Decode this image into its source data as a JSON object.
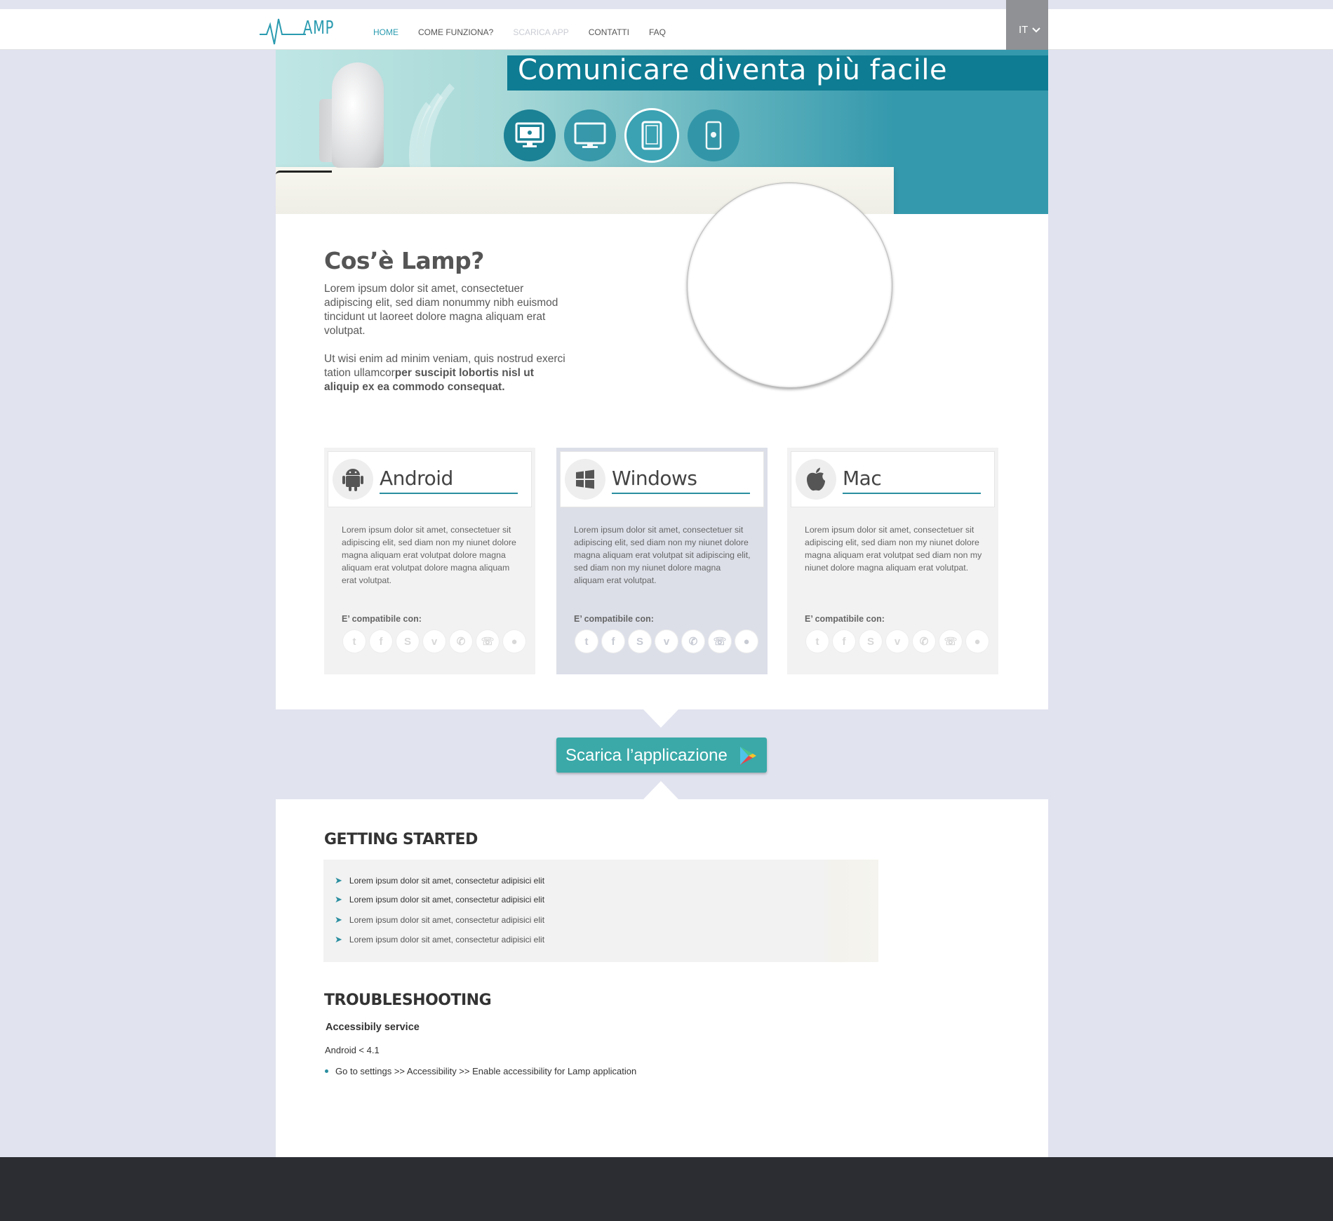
{
  "header": {
    "logo_text": "AMP",
    "nav": [
      {
        "label": "HOME",
        "state": "active"
      },
      {
        "label": "COME FUNZIONA?",
        "state": "normal"
      },
      {
        "label": "SCARICA APP",
        "state": "muted"
      },
      {
        "label": "CONTATTI",
        "state": "normal"
      },
      {
        "label": "FAQ",
        "state": "normal"
      }
    ],
    "language": "IT"
  },
  "hero": {
    "title": "Comunicare diventa più facile",
    "device_icons": [
      "mac-desktop-icon",
      "monitor-icon",
      "tablet-icon",
      "android-phone-icon"
    ],
    "selected_device": "tablet-icon"
  },
  "intro": {
    "title": "Cos’è Lamp?",
    "p1": "Lorem ipsum dolor sit amet, consectetuer adipiscing elit, sed diam nonummy nibh euismod tincidunt ut laoreet dolore magna aliquam erat volutpat.",
    "p2_plain": "Ut wisi enim ad minim veniam, quis nostrud exerci tation ullamcor",
    "p2_bold": "per suscipit lobortis nisl ut aliquip ex ea commodo consequat."
  },
  "platforms": [
    {
      "name": "Android",
      "icon": "android-icon",
      "text": "Lorem ipsum dolor sit amet, consectetuer sit adipiscing elit, sed diam non my niunet dolore magna aliquam erat volutpat dolore magna aliquam erat volutpat dolore magna aliquam erat volutpat.",
      "compat_label": "E’ compatibile con:"
    },
    {
      "name": "Windows",
      "icon": "windows-icon",
      "text": "Lorem ipsum dolor sit amet, consectetuer sit adipiscing elit, sed diam non my niunet dolore magna aliquam erat volutpat sit adipiscing elit, sed diam non my niunet dolore magna aliquam erat volutpat.",
      "compat_label": "E’ compatibile con:"
    },
    {
      "name": "Mac",
      "icon": "apple-icon",
      "text": "Lorem ipsum dolor sit amet, consectetuer sit adipiscing elit, sed diam non my niunet dolore magna aliquam erat volutpat sed diam non my niunet dolore magna aliquam erat volutpat.",
      "compat_label": "E’ compatibile con:"
    }
  ],
  "compat_apps": [
    "twitter-icon",
    "facebook-icon",
    "skype-icon",
    "viber-icon",
    "phone-icon",
    "whatsapp-icon",
    "line-icon"
  ],
  "cta": {
    "label": "Scarica l’applicazione",
    "icon": "google-play-icon"
  },
  "getting_started": {
    "title": "GETTING STARTED",
    "items": [
      "Lorem ipsum dolor sit amet, consectetur adipisici elit",
      "Lorem ipsum dolor sit amet, consectetur adipisici elit",
      "Lorem ipsum dolor sit amet, consectetur adipisici elit",
      "Lorem ipsum dolor sit amet, consectetur adipisici elit"
    ]
  },
  "troubleshooting": {
    "title": "TROUBLESHOOTING",
    "heading": "Accessibily service",
    "version": "Android < 4.1",
    "steps": [
      "Go to settings >> Accessibility >> Enable accessibility for Lamp application"
    ]
  },
  "colors": {
    "accent": "#2a9bb0",
    "hero_band": "#0e7c93",
    "cta": "#3aa9a8",
    "page_bg": "#e1e3ef",
    "footer": "#2b2d33"
  }
}
